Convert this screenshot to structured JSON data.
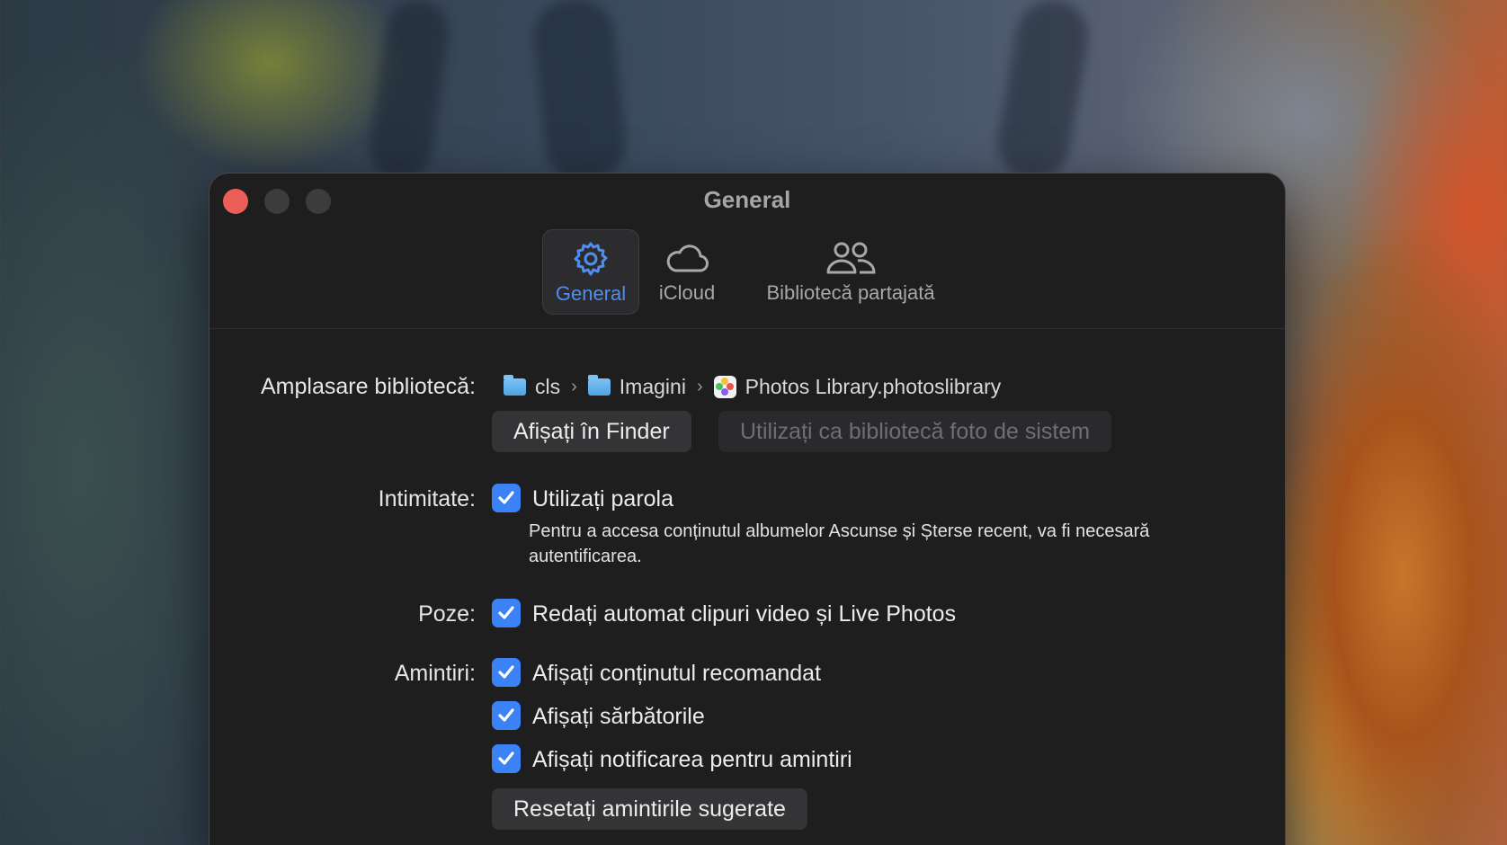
{
  "window": {
    "title": "General"
  },
  "toolbar": {
    "tabs": [
      {
        "label": "General",
        "icon": "gear-icon",
        "active": true
      },
      {
        "label": "iCloud",
        "icon": "cloud-icon",
        "active": false
      },
      {
        "label": "Bibliotecă partajată",
        "icon": "people-icon",
        "active": false
      }
    ]
  },
  "library": {
    "label": "Amplasare bibliotecă:",
    "path": [
      "cls",
      "Imagini",
      "Photos Library.photoslibrary"
    ],
    "show_in_finder": "Afișați în Finder",
    "use_as_system": "Utilizați ca bibliotecă foto de sistem"
  },
  "privacy": {
    "label": "Intimitate:",
    "use_password": "Utilizați parola",
    "use_password_checked": true,
    "help": "Pentru a accesa conținutul albumelor Ascunse și Șterse recent, va fi necesară autentificarea."
  },
  "photos": {
    "label": "Poze:",
    "autoplay": "Redați automat clipuri video și Live Photos",
    "autoplay_checked": true
  },
  "memories": {
    "label": "Amintiri:",
    "options": [
      {
        "label": "Afișați conținutul recomandat",
        "checked": true
      },
      {
        "label": "Afișați sărbătorile",
        "checked": true
      },
      {
        "label": "Afișați notificarea pentru amintiri",
        "checked": true
      }
    ],
    "reset_button": "Resetați amintirile sugerate"
  },
  "colors": {
    "accent": "#3b82f6",
    "close": "#ec5f58",
    "window_bg": "#1e1e1f"
  }
}
